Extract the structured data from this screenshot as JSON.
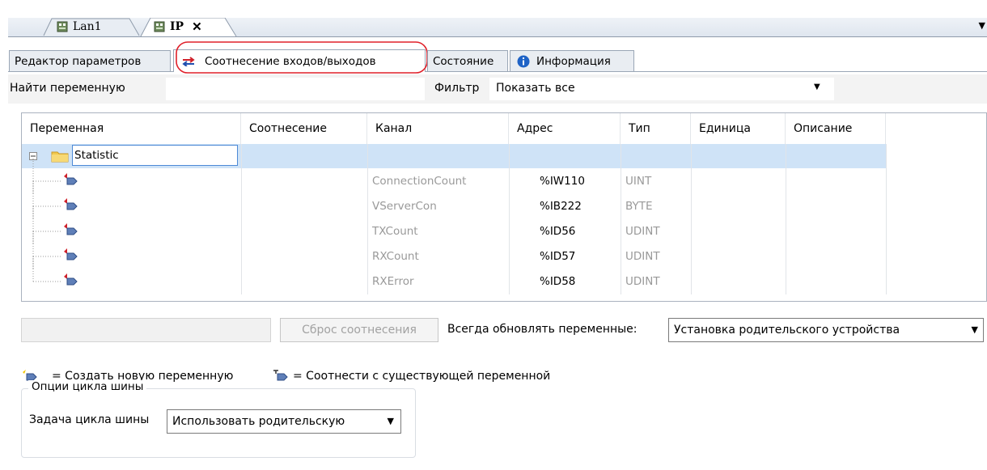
{
  "doc_tabs": [
    {
      "label": "Lan1",
      "active": false
    },
    {
      "label": "IP",
      "active": true,
      "close_glyph": "✕"
    }
  ],
  "inner_tabs": [
    {
      "label": "Редактор параметров"
    },
    {
      "label": "Соотнесение входов/выходов",
      "active": true,
      "highlighted": true
    },
    {
      "label": "Состояние"
    },
    {
      "label": "Информация"
    }
  ],
  "find": {
    "label": "Найти переменную"
  },
  "filter": {
    "label": "Фильтр",
    "value": "Показать все"
  },
  "table": {
    "columns": [
      "Переменная",
      "Соотнесение",
      "Канал",
      "Адрес",
      "Тип",
      "Единица",
      "Описание"
    ],
    "group": {
      "name": "Statistic",
      "expanded": true
    },
    "rows": [
      {
        "channel": "ConnectionCount",
        "address": "%IW110",
        "type": "UINT"
      },
      {
        "channel": "VServerCon",
        "address": "%IB222",
        "type": "BYTE"
      },
      {
        "channel": "TXCount",
        "address": "%ID56",
        "type": "UDINT"
      },
      {
        "channel": "RXCount",
        "address": "%ID57",
        "type": "UDINT"
      },
      {
        "channel": "RXError",
        "address": "%ID58",
        "type": "UDINT"
      }
    ]
  },
  "reset_button": "Сброс соотнесения",
  "always_update": {
    "label": "Всегда обновлять переменные:",
    "value": "Установка родительского устройства"
  },
  "legend": {
    "new_var": "= Создать новую переменную",
    "existing_var": "= Соотнести с существующей переменной"
  },
  "bus_cycle": {
    "group_title": "Опции цикла шины",
    "task_label": "Задача цикла шины",
    "task_value": "Использовать родительскую"
  },
  "icons": {
    "folder": "folder-icon",
    "mapping": "io-mapping-icon",
    "info": "info-icon",
    "variable": "variable-map-icon",
    "device": "device-icon"
  },
  "colors": {
    "selection_row": "#cfe3f7",
    "highlight_ring": "#e0202a",
    "info_blue": "#1f63c6",
    "folder_yellow": "#f1c84d"
  }
}
